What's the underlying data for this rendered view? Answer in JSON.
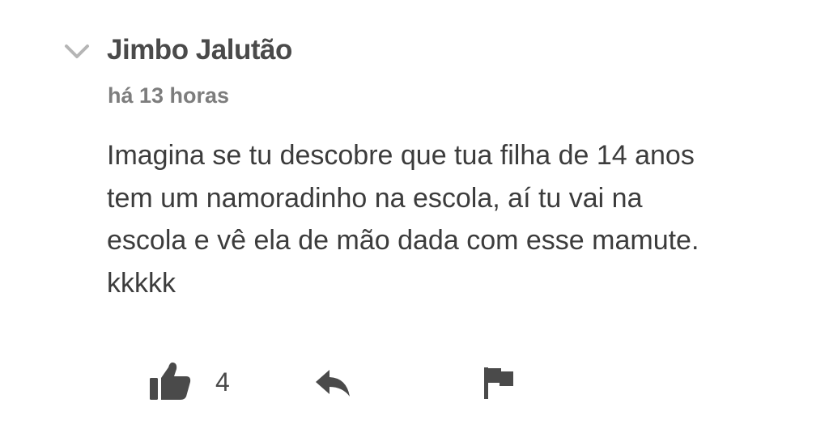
{
  "comment": {
    "author": "Jimbo Jalutão",
    "timestamp": "há 13 horas",
    "body_lines": [
      "Imagina se tu descobre que tua filha de 14 anos",
      "tem um namoradinho na escola, aí tu vai na",
      "escola e vê ela de mão dada com esse mamute.",
      "kkkkk"
    ],
    "likes": "4"
  },
  "icons": {
    "collapse": "chevron-down-icon",
    "like": "thumbs-up-icon",
    "reply": "reply-arrow-icon",
    "flag": "flag-icon"
  },
  "colors": {
    "author": "#4a4a4a",
    "timestamp": "#7d7d7d",
    "body": "#3c3c3c",
    "icon": "#4a4a4a",
    "chevron": "#b5b5b5"
  }
}
